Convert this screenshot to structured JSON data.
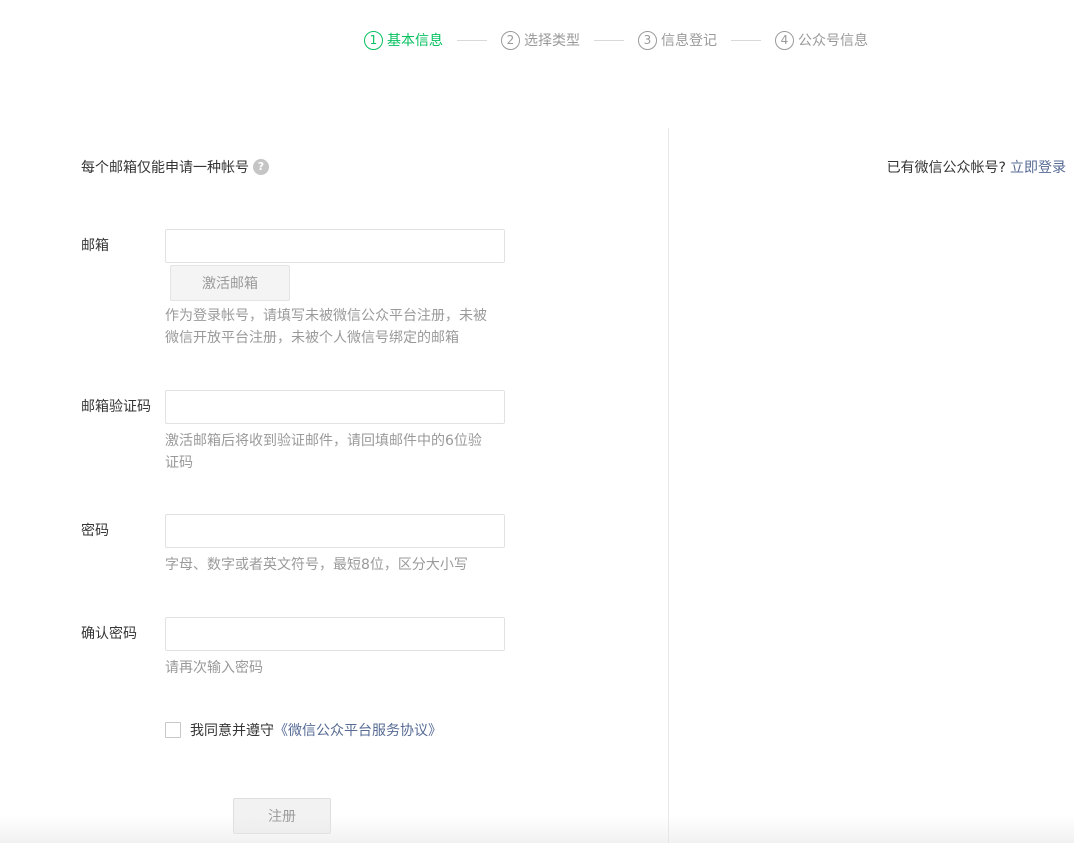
{
  "steps": [
    {
      "num": "1",
      "label": "基本信息",
      "active": true
    },
    {
      "num": "2",
      "label": "选择类型",
      "active": false
    },
    {
      "num": "3",
      "label": "信息登记",
      "active": false
    },
    {
      "num": "4",
      "label": "公众号信息",
      "active": false
    }
  ],
  "form": {
    "tip": "每个邮箱仅能申请一种帐号",
    "help_glyph": "?",
    "email": {
      "label": "邮箱",
      "value": "",
      "placeholder": "",
      "activate_button": "激活邮箱",
      "hint": "作为登录帐号，请填写未被微信公众平台注册，未被微信开放平台注册，未被个人微信号绑定的邮箱"
    },
    "code": {
      "label": "邮箱验证码",
      "value": "",
      "placeholder": "",
      "hint": "激活邮箱后将收到验证邮件，请回填邮件中的6位验证码"
    },
    "password": {
      "label": "密码",
      "value": "",
      "placeholder": "",
      "hint": "字母、数字或者英文符号，最短8位，区分大小写"
    },
    "confirm": {
      "label": "确认密码",
      "value": "",
      "placeholder": "",
      "hint": "请再次输入密码"
    },
    "agree": {
      "checked": false,
      "text": "我同意并遵守",
      "link": "《微信公众平台服务协议》"
    },
    "register_button": "注册"
  },
  "side": {
    "question": "已有微信公众帐号?",
    "login_link": "立即登录"
  },
  "colors": {
    "accent": "#07c160",
    "link": "#576b95",
    "muted": "#9a9a9a"
  }
}
